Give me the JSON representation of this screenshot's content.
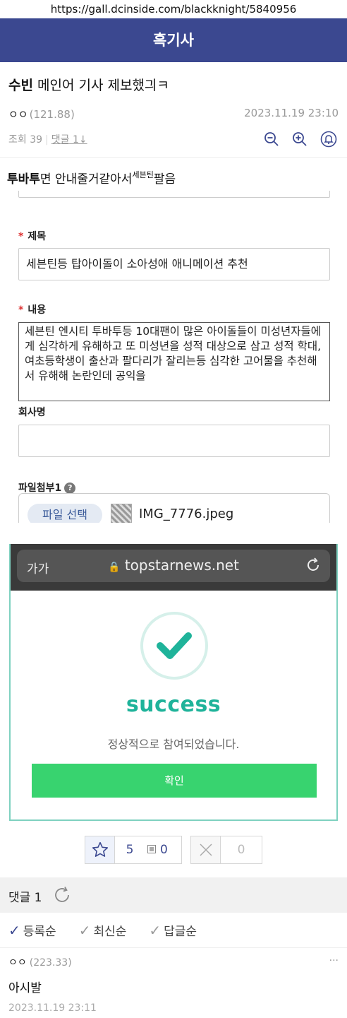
{
  "browser": {
    "url": "https://gall.dcinside.com/blackknight/5840956"
  },
  "gallery": {
    "title": "흑기사"
  },
  "post": {
    "title_strong": "수빈",
    "title_rest": " 메인어 기사 제보했긔ㅋ",
    "author": "ㅇㅇ",
    "author_ip": "(121.88)",
    "date": "2023.11.19 23:10",
    "views": "조회 39",
    "comments_link": "댓글 1↓",
    "body_strong": "투바투",
    "body_text": "면 안내줄거같아서",
    "body_sup": "세븐틴",
    "body_end": "팔음"
  },
  "form": {
    "subject_label": "제목",
    "subject_value": "세븐틴등 탑아이돌이 소아성애 애니메이션 추천",
    "content_label": "내용",
    "content_value": "세븐틴 엔시티 투바투등 10대팬이 많은 아이돌들이 미성년자들에게 심각하게 유해하고 또 미성년을 성적 대상으로 삼고 성적 학대, 여초등학생이 출산과 팔다리가 잘리는등 심각한 고어물을 추천해서 유해해 논란인데 공익을",
    "company_label": "회사명",
    "company_value": "",
    "attach_label": "파일첨부1",
    "attach_help": "?",
    "file_button": "파일 선택",
    "file_name": "IMG_7776.jpeg"
  },
  "popup": {
    "aa": "가가",
    "lock": "🔒",
    "domain": "topstarnews.net",
    "success_title": "success",
    "message": "정상적으로 참여되었습니다.",
    "confirm": "확인"
  },
  "reco": {
    "up": "5",
    "fixed": "0",
    "down": "0"
  },
  "comments": {
    "header": "댓글 1",
    "sort": [
      "등록순",
      "최신순",
      "답글순"
    ],
    "items": [
      {
        "author": "ㅇㅇ",
        "ip": "(223.33)",
        "text": "아시발",
        "date": "2023.11.19 23:11",
        "more": "···"
      }
    ]
  },
  "colors": {
    "header_bg": "#3b4890",
    "success": "#1fb39a",
    "confirm_bg": "#38d36f"
  }
}
